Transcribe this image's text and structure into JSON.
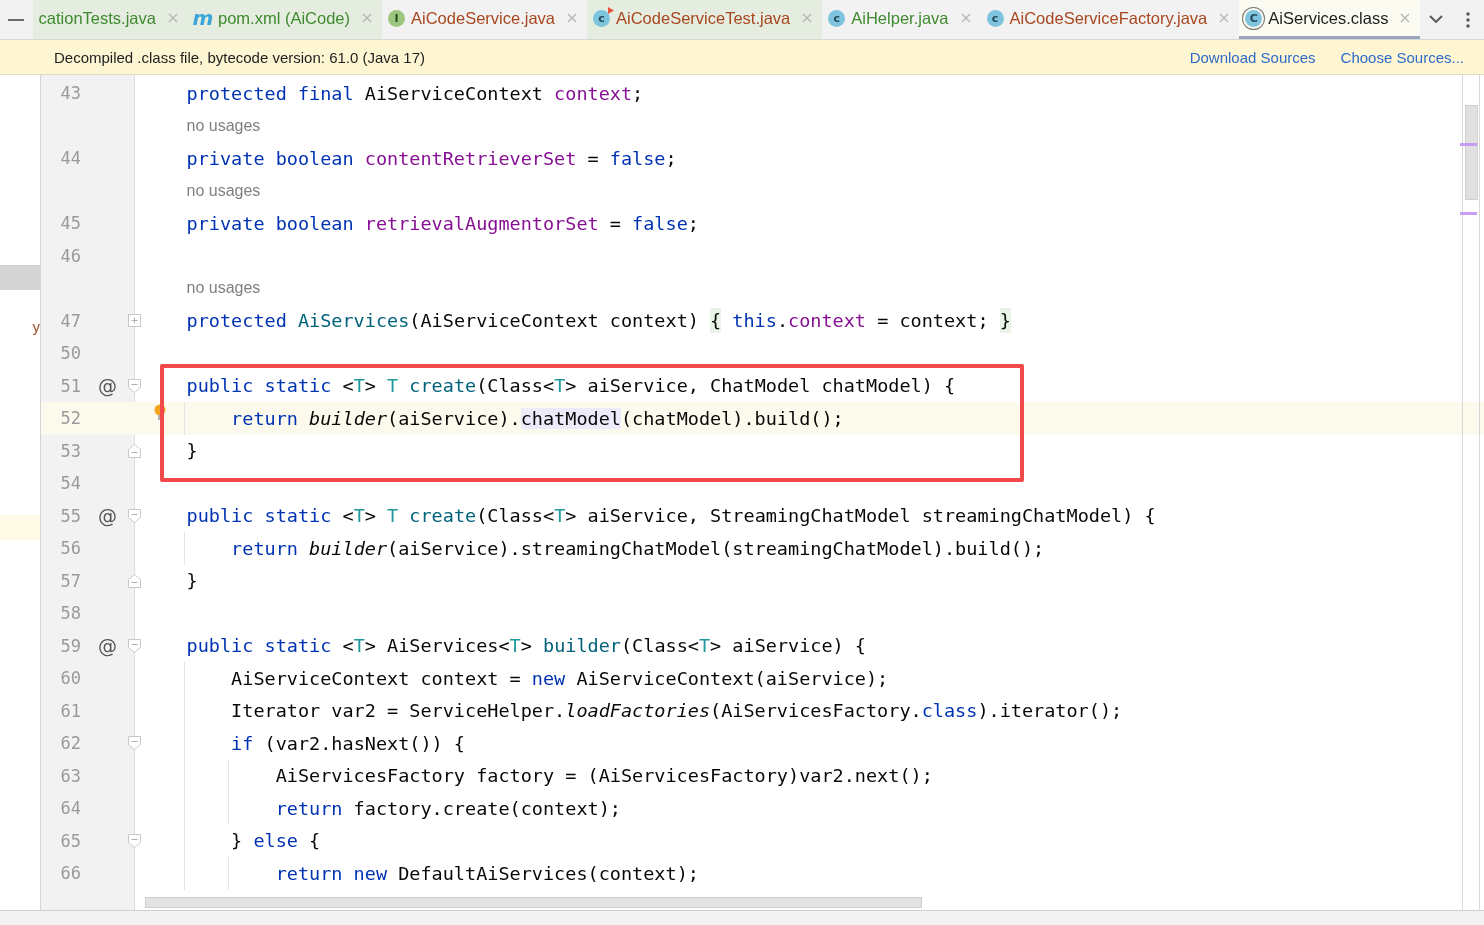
{
  "tabs": [
    {
      "label": "cationTests.java",
      "selected": false,
      "tinted": true,
      "color": "#3f8a2e"
    },
    {
      "label": "pom.xml (AiCode)",
      "selected": false,
      "tinted": true,
      "color": "#3f8a2e",
      "icon": {
        "kind": "maven",
        "glyph": "m"
      }
    },
    {
      "label": "AiCodeService.java",
      "selected": false,
      "tinted": false,
      "color": "#a8471f",
      "icon": {
        "kind": "interface",
        "glyph": "I"
      }
    },
    {
      "label": "AiCodeServiceTest.java",
      "selected": false,
      "tinted": true,
      "color": "#a8471f",
      "icon": {
        "kind": "class-run",
        "glyph": "c"
      }
    },
    {
      "label": "AiHelper.java",
      "selected": false,
      "tinted": false,
      "color": "#3f8a2e",
      "icon": {
        "kind": "class",
        "glyph": "c"
      }
    },
    {
      "label": "AiCodeServiceFactory.java",
      "selected": false,
      "tinted": false,
      "color": "#a8471f",
      "icon": {
        "kind": "class",
        "glyph": "c"
      }
    },
    {
      "label": "AiServices.class",
      "selected": true,
      "tinted": false,
      "color": "#1e1e1e",
      "icon": {
        "kind": "class-decompiled",
        "glyph": "C"
      }
    }
  ],
  "banner": {
    "text": "Decompiled .class file, bytecode version: 61.0 (Java 17)",
    "links": [
      "Download Sources",
      "Choose Sources..."
    ]
  },
  "side_panel": {
    "fragment": "y"
  },
  "rows": [
    {
      "kind": "code",
      "number": "43",
      "code": [
        {
          "kind": "keyword",
          "text": "    protected final"
        },
        {
          "kind": "plain",
          "text": " AiServiceContext "
        },
        {
          "kind": "field",
          "text": "context"
        },
        {
          "kind": "plain",
          "text": ";"
        }
      ]
    },
    {
      "kind": "hint",
      "text": "no usages"
    },
    {
      "kind": "code",
      "number": "44",
      "code": [
        {
          "kind": "keyword",
          "text": "    private boolean"
        },
        {
          "kind": "field",
          "text": " contentRetrieverSet"
        },
        {
          "kind": "plain",
          "text": " = "
        },
        {
          "kind": "keyword",
          "text": "false"
        },
        {
          "kind": "plain",
          "text": ";"
        }
      ]
    },
    {
      "kind": "hint",
      "text": "no usages"
    },
    {
      "kind": "code",
      "number": "45",
      "code": [
        {
          "kind": "keyword",
          "text": "    private boolean"
        },
        {
          "kind": "field",
          "text": " retrievalAugmentorSet"
        },
        {
          "kind": "plain",
          "text": " = "
        },
        {
          "kind": "keyword",
          "text": "false"
        },
        {
          "kind": "plain",
          "text": ";"
        }
      ]
    },
    {
      "kind": "code",
      "number": "46"
    },
    {
      "kind": "hint",
      "text": "no usages"
    },
    {
      "kind": "code",
      "number": "47",
      "fold": {
        "kind": "expand"
      },
      "code": [
        {
          "kind": "keyword",
          "text": "    protected"
        },
        {
          "kind": "method",
          "text": " AiServices"
        },
        {
          "kind": "plain",
          "text": "(AiServiceContext context) "
        },
        {
          "kind": "folded",
          "text": "{"
        },
        {
          "kind": "keyword",
          "text": " this"
        },
        {
          "kind": "plain",
          "text": "."
        },
        {
          "kind": "field",
          "text": "context"
        },
        {
          "kind": "plain",
          "text": " = context; "
        },
        {
          "kind": "folded",
          "text": "}"
        }
      ]
    },
    {
      "kind": "code",
      "number": "50"
    },
    {
      "kind": "code",
      "number": "51",
      "boxed": true,
      "marker": "@",
      "fold": {
        "kind": "start"
      },
      "code": [
        {
          "kind": "keyword",
          "text": "    public static"
        },
        {
          "kind": "plain",
          "text": " <"
        },
        {
          "kind": "typeparam",
          "text": "T"
        },
        {
          "kind": "plain",
          "text": "> "
        },
        {
          "kind": "typeparam",
          "text": "T"
        },
        {
          "kind": "method",
          "text": " create"
        },
        {
          "kind": "plain",
          "text": "(Class<"
        },
        {
          "kind": "typeparam",
          "text": "T"
        },
        {
          "kind": "plain",
          "text": "> aiService, ChatModel chatModel) {"
        }
      ]
    },
    {
      "kind": "code",
      "number": "52",
      "current": true,
      "boxed": true,
      "intention": true,
      "code": [
        {
          "kind": "keyword",
          "text": "        return"
        },
        {
          "kind": "italic",
          "text": " builder"
        },
        {
          "kind": "plain",
          "text": "(aiService)."
        },
        {
          "kind": "usage",
          "text": "chatModel"
        },
        {
          "kind": "plain",
          "text": "(chatModel).build();"
        }
      ]
    },
    {
      "kind": "code",
      "number": "53",
      "boxed": true,
      "fold": {
        "kind": "end"
      },
      "code": [
        {
          "kind": "plain",
          "text": "    }"
        }
      ]
    },
    {
      "kind": "code",
      "number": "54"
    },
    {
      "kind": "code",
      "number": "55",
      "marker": "@",
      "fold": {
        "kind": "start"
      },
      "code": [
        {
          "kind": "keyword",
          "text": "    public static"
        },
        {
          "kind": "plain",
          "text": " <"
        },
        {
          "kind": "typeparam",
          "text": "T"
        },
        {
          "kind": "plain",
          "text": "> "
        },
        {
          "kind": "typeparam",
          "text": "T"
        },
        {
          "kind": "method",
          "text": " create"
        },
        {
          "kind": "plain",
          "text": "(Class<"
        },
        {
          "kind": "typeparam",
          "text": "T"
        },
        {
          "kind": "plain",
          "text": "> aiService, StreamingChatModel streamingChatModel) {"
        }
      ]
    },
    {
      "kind": "code",
      "number": "56",
      "code": [
        {
          "kind": "keyword",
          "text": "        return"
        },
        {
          "kind": "italic",
          "text": " builder"
        },
        {
          "kind": "plain",
          "text": "(aiService).streamingChatModel(streamingChatModel).build();"
        }
      ]
    },
    {
      "kind": "code",
      "number": "57",
      "fold": {
        "kind": "end"
      },
      "code": [
        {
          "kind": "plain",
          "text": "    }"
        }
      ]
    },
    {
      "kind": "code",
      "number": "58"
    },
    {
      "kind": "code",
      "number": "59",
      "marker": "@",
      "fold": {
        "kind": "start"
      },
      "code": [
        {
          "kind": "keyword",
          "text": "    public static"
        },
        {
          "kind": "plain",
          "text": " <"
        },
        {
          "kind": "typeparam",
          "text": "T"
        },
        {
          "kind": "plain",
          "text": "> AiServices<"
        },
        {
          "kind": "typeparam",
          "text": "T"
        },
        {
          "kind": "plain",
          "text": "> "
        },
        {
          "kind": "method",
          "text": "builder"
        },
        {
          "kind": "plain",
          "text": "(Class<"
        },
        {
          "kind": "typeparam",
          "text": "T"
        },
        {
          "kind": "plain",
          "text": "> aiService) {"
        }
      ]
    },
    {
      "kind": "code",
      "number": "60",
      "code": [
        {
          "kind": "plain",
          "text": "        AiServiceContext context = "
        },
        {
          "kind": "keyword",
          "text": "new"
        },
        {
          "kind": "plain",
          "text": " AiServiceContext(aiService);"
        }
      ]
    },
    {
      "kind": "code",
      "number": "61",
      "code": [
        {
          "kind": "plain",
          "text": "        Iterator var2 = ServiceHelper."
        },
        {
          "kind": "italic",
          "text": "loadFactories"
        },
        {
          "kind": "plain",
          "text": "(AiServicesFactory."
        },
        {
          "kind": "keyword",
          "text": "class"
        },
        {
          "kind": "plain",
          "text": ").iterator();"
        }
      ]
    },
    {
      "kind": "code",
      "number": "62",
      "fold": {
        "kind": "start"
      },
      "code": [
        {
          "kind": "keyword",
          "text": "        if"
        },
        {
          "kind": "plain",
          "text": " (var2.hasNext()) {"
        }
      ]
    },
    {
      "kind": "code",
      "number": "63",
      "code": [
        {
          "kind": "plain",
          "text": "            AiServicesFactory factory = (AiServicesFactory)var2.next();"
        }
      ]
    },
    {
      "kind": "code",
      "number": "64",
      "code": [
        {
          "kind": "keyword",
          "text": "            return"
        },
        {
          "kind": "plain",
          "text": " factory.create(context);"
        }
      ]
    },
    {
      "kind": "code",
      "number": "65",
      "fold": {
        "kind": "start"
      },
      "code": [
        {
          "kind": "plain",
          "text": "        } "
        },
        {
          "kind": "keyword",
          "text": "else"
        },
        {
          "kind": "plain",
          "text": " {"
        }
      ]
    },
    {
      "kind": "code",
      "number": "66",
      "code": [
        {
          "kind": "keyword",
          "text": "            return new"
        },
        {
          "kind": "plain",
          "text": " DefaultAiServices(context);"
        }
      ]
    }
  ]
}
